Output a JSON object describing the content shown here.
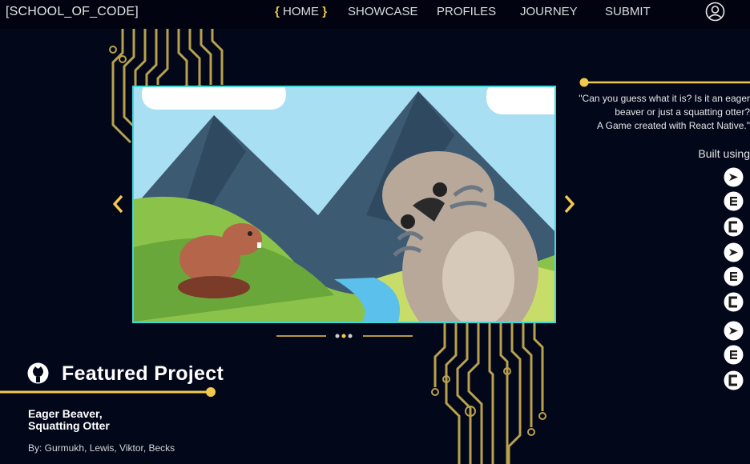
{
  "nav": {
    "brand": "[SCHOOL_OF_CODE]",
    "home_open": "{",
    "home_label": "HOME",
    "home_close": "}",
    "showcase": "SHOWCASE",
    "profiles": "PROFILES",
    "journey": "JOURNEY",
    "submit": "SUBMIT",
    "user_icon": "user-circle-icon"
  },
  "carousel": {
    "prev_icon": "chevron-left-icon",
    "next_icon": "chevron-right-icon",
    "slide_count": 3,
    "active_slide": 2
  },
  "project": {
    "description_line1": "\"Can you guess what it is? Is it an eager",
    "description_line2": "beaver or just a squatting otter?",
    "description_line3": "A Game created with React Native.\"",
    "built_label": "Built using",
    "tech_icons": [
      "expo-icon",
      "express-icon",
      "codesandbox-icon",
      "expo-icon",
      "express-icon",
      "codesandbox-icon",
      "expo-icon",
      "express-icon",
      "codesandbox-icon"
    ]
  },
  "featured": {
    "title": "Featured Project",
    "icon": "github-icon",
    "name_line1": "Eager Beaver,",
    "name_line2": "Squatting Otter",
    "authors": "By: Gurmukh, Lewis, Viktor, Becks"
  },
  "colors": {
    "background": "#03071a",
    "accent": "#f2c94c",
    "circuit": "#b9a14c",
    "slide_border": "#3fd8d8"
  }
}
